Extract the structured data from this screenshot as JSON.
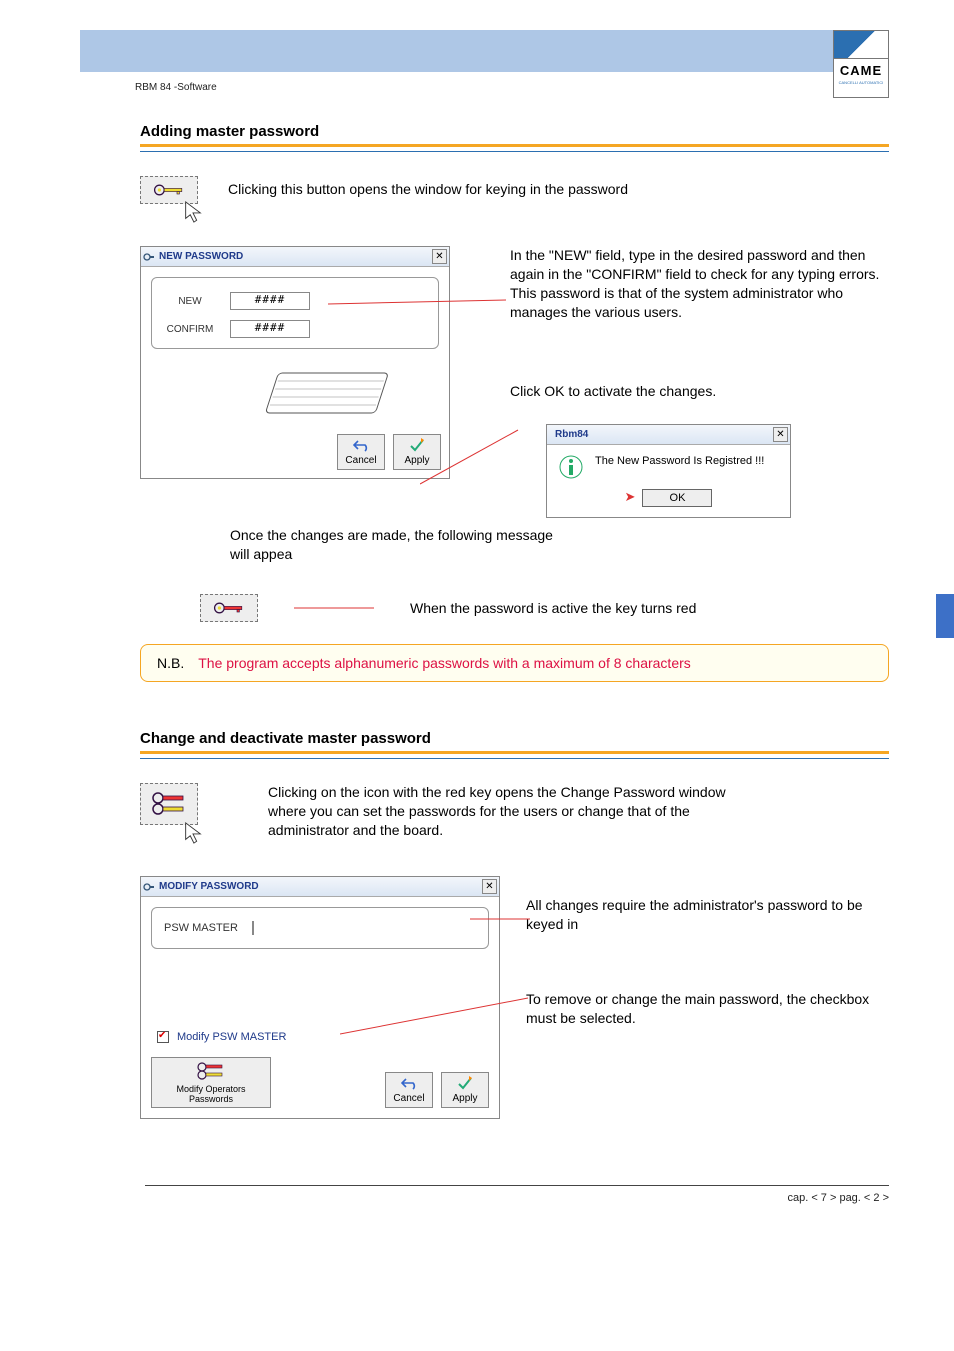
{
  "header": {
    "doc_ref": "RBM 84 -Software",
    "logo": "CAME",
    "logo_sub": "CANCELLI AUTOMATICI"
  },
  "section1": {
    "title": "Adding master password",
    "intro": "Clicking this button opens the window for keying in the password",
    "dialog": {
      "title": "NEW PASSWORD",
      "new_label": "NEW",
      "confirm_label": "CONFIRM",
      "new_value": "####",
      "confirm_value": "####",
      "cancel": "Cancel",
      "apply": "Apply"
    },
    "explain": "In the \"NEW\" field, type in the desired password and then again in the \"CONFIRM\" field to check for any typing errors. This password is that of the system administrator who manages the various users.",
    "click_ok": "Click OK to activate the changes.",
    "once_msg": "Once the changes are made, the following message will appea",
    "msgbox": {
      "title": "Rbm84",
      "text": "The New Password Is Registred !!!",
      "ok": "OK"
    },
    "key_red_text": "When the password is active the key turns red",
    "nb_label": "N.B.",
    "nb_text": "The program accepts alphanumeric passwords with a maximum of 8 characters"
  },
  "section2": {
    "title": "Change and deactivate master password",
    "intro": "Clicking on the icon with the red key opens the Change Password window where you can set the passwords for the users or change that of the administrator and the board.",
    "dialog": {
      "title": "MODIFY PASSWORD",
      "psw_master_label": "PSW MASTER",
      "modify_psw_label": "Modify PSW MASTER",
      "operators_btn": "Modify Operators Passwords",
      "cancel": "Cancel",
      "apply": "Apply"
    },
    "para_admin": "All changes require the administrator's password to be keyed in",
    "para_remove": "To remove or change the main password, the checkbox must be selected."
  },
  "footer": {
    "text": "cap. < 7 > pag. < 2 >"
  }
}
